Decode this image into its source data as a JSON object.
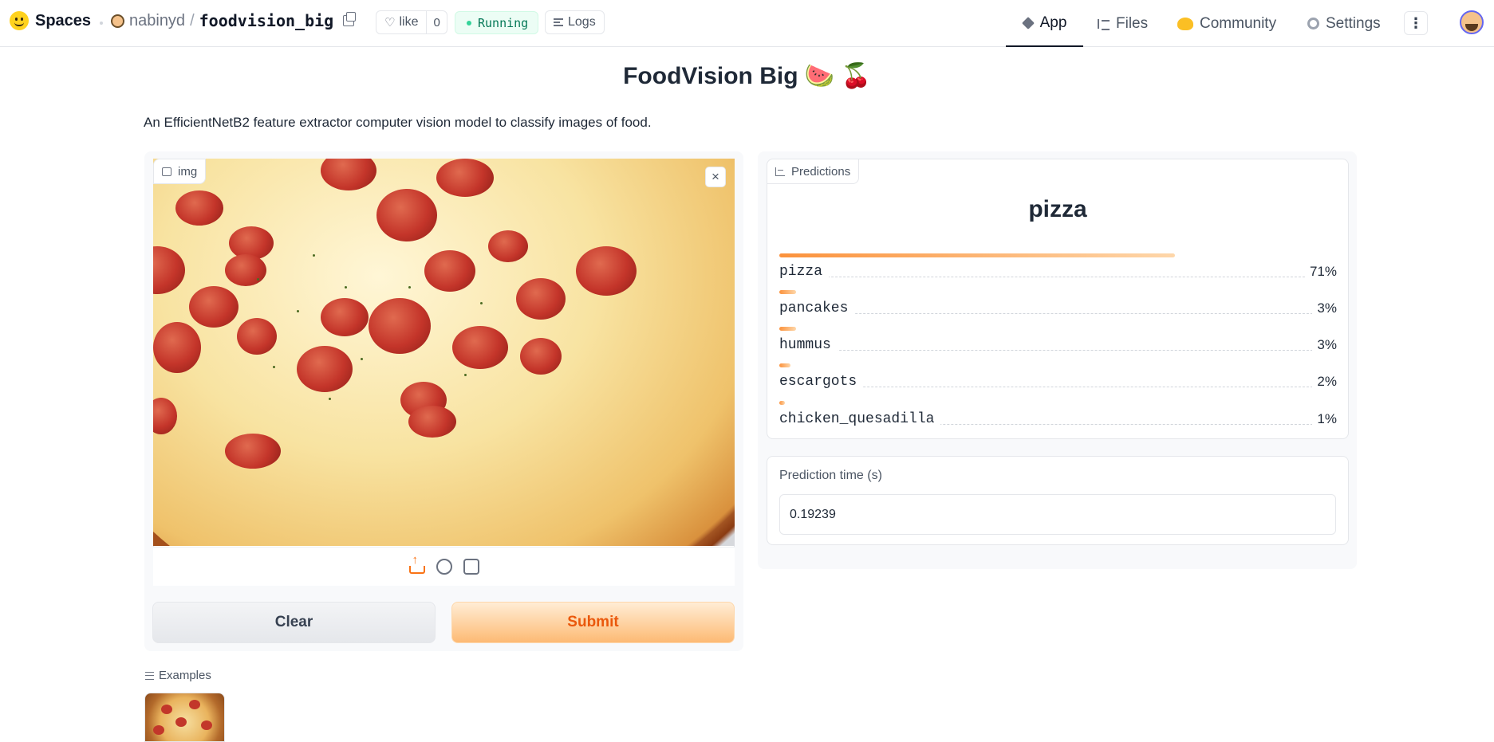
{
  "header": {
    "logo_text": "Spaces",
    "owner": "nabinyd",
    "slash": "/",
    "repo_name": "foodvision_big",
    "like_label": "like",
    "like_count": "0",
    "status": "Running",
    "logs_label": "Logs",
    "nav": {
      "app": "App",
      "files": "Files",
      "community": "Community",
      "settings": "Settings"
    },
    "more_glyph": "⋮"
  },
  "app": {
    "title": "FoodVision Big 🍉 🍒",
    "description": "An EfficientNetB2 feature extractor computer vision model to classify images of food.",
    "image_label": "img",
    "close_glyph": "×",
    "clear_label": "Clear",
    "submit_label": "Submit",
    "examples_label": "Examples"
  },
  "predictions": {
    "label": "Predictions",
    "top_class": "pizza",
    "items": [
      {
        "name": "pizza",
        "value": "71%",
        "confidence": 0.71
      },
      {
        "name": "pancakes",
        "value": "3%",
        "confidence": 0.03
      },
      {
        "name": "hummus",
        "value": "3%",
        "confidence": 0.03
      },
      {
        "name": "escargots",
        "value": "2%",
        "confidence": 0.02
      },
      {
        "name": "chicken_quesadilla",
        "value": "1%",
        "confidence": 0.01
      }
    ]
  },
  "prediction_time": {
    "label": "Prediction time (s)",
    "value": "0.19239"
  },
  "colors": {
    "accent": "#f97316",
    "status_bg": "#ecfdf5",
    "status_text": "#047857"
  }
}
